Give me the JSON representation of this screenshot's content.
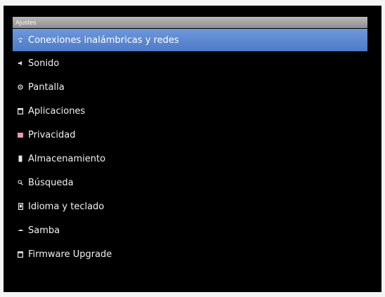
{
  "window": {
    "title": "Ajustes"
  },
  "menu": {
    "items": [
      {
        "label": "Conexiones inalámbricas y redes",
        "icon": "wireless-icon",
        "selected": true
      },
      {
        "label": "Sonido",
        "icon": "speaker-icon",
        "selected": false
      },
      {
        "label": "Pantalla",
        "icon": "display-icon",
        "selected": false
      },
      {
        "label": "Aplicaciones",
        "icon": "apps-icon",
        "selected": false
      },
      {
        "label": "Privacidad",
        "icon": "privacy-icon",
        "selected": false
      },
      {
        "label": "Almacenamiento",
        "icon": "storage-icon",
        "selected": false
      },
      {
        "label": "Búsqueda",
        "icon": "search-icon",
        "selected": false
      },
      {
        "label": "Idioma y teclado",
        "icon": "language-icon",
        "selected": false
      },
      {
        "label": "Samba",
        "icon": "samba-icon",
        "selected": false
      },
      {
        "label": "Firmware Upgrade",
        "icon": "firmware-icon",
        "selected": false
      }
    ]
  },
  "colors": {
    "selection": "#5a86d0",
    "background": "#000000",
    "titlebar": "#a3a3a3"
  }
}
